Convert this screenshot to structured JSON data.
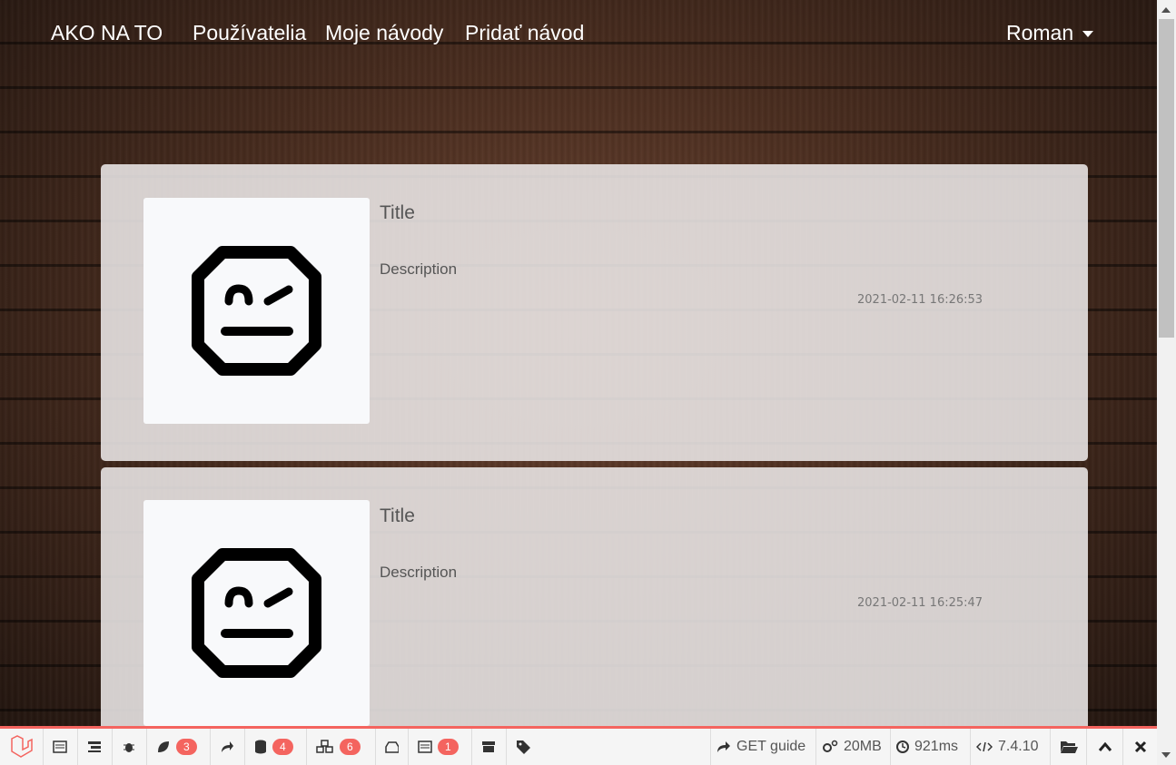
{
  "navbar": {
    "brand": "AKO NA TO",
    "links": [
      "Používatelia",
      "Moje návody",
      "Pridať návod"
    ],
    "user": "Roman"
  },
  "cards": [
    {
      "title": "Title",
      "description": "Description",
      "date": "2021-02-11 16:26:53",
      "image_icon": "robot-face-icon"
    },
    {
      "title": "Title",
      "description": "Description",
      "date": "2021-02-11 16:25:47",
      "image_icon": "robot-face-icon"
    }
  ],
  "debugbar": {
    "accent_color": "#f4645f",
    "badges": {
      "views": "3",
      "queries": "4",
      "models": "6",
      "messages": "1"
    },
    "request": "GET guide",
    "memory": "20MB",
    "time": "921ms",
    "php_version": "7.4.10"
  }
}
